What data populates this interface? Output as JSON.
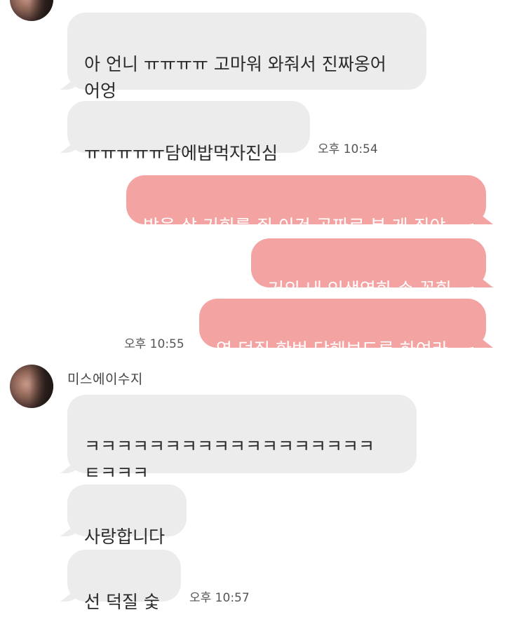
{
  "chat": {
    "messages": [
      {
        "id": "m1",
        "side": "in",
        "text": "아 언니 ㅠㅠㅠㅠ 고마워 와줘서 진짜옹어\n어엉"
      },
      {
        "id": "m2",
        "side": "in",
        "text": "ㅠㅠㅠㅠㅠ담에밥먹자진심",
        "time": "오후 10:54"
      },
      {
        "id": "m3",
        "side": "out",
        "text": "밥을 살 기회를 줘 이건 공짜로 본 게 죄야"
      },
      {
        "id": "m4",
        "side": "out",
        "text": "거의 내 인생영화 손 꼽힘"
      },
      {
        "id": "m5",
        "side": "out",
        "text": "역 덕질 한번 당해보도록 하여라",
        "time": "오후 10:55"
      },
      {
        "id": "m6",
        "side": "in",
        "text": "ㅋㅋㅋㅋㅋㅋㅋㅋㅋㅋㅋㅋㅋㅋㅋㅋㅋㅋ\nㅌㅋㅋㅋ"
      },
      {
        "id": "m7",
        "side": "in",
        "text": "사랑합니다"
      },
      {
        "id": "m8",
        "side": "in",
        "text": "선 덕질 숯",
        "time": "오후 10:57"
      }
    ],
    "sender_name": "미스에이수지"
  }
}
